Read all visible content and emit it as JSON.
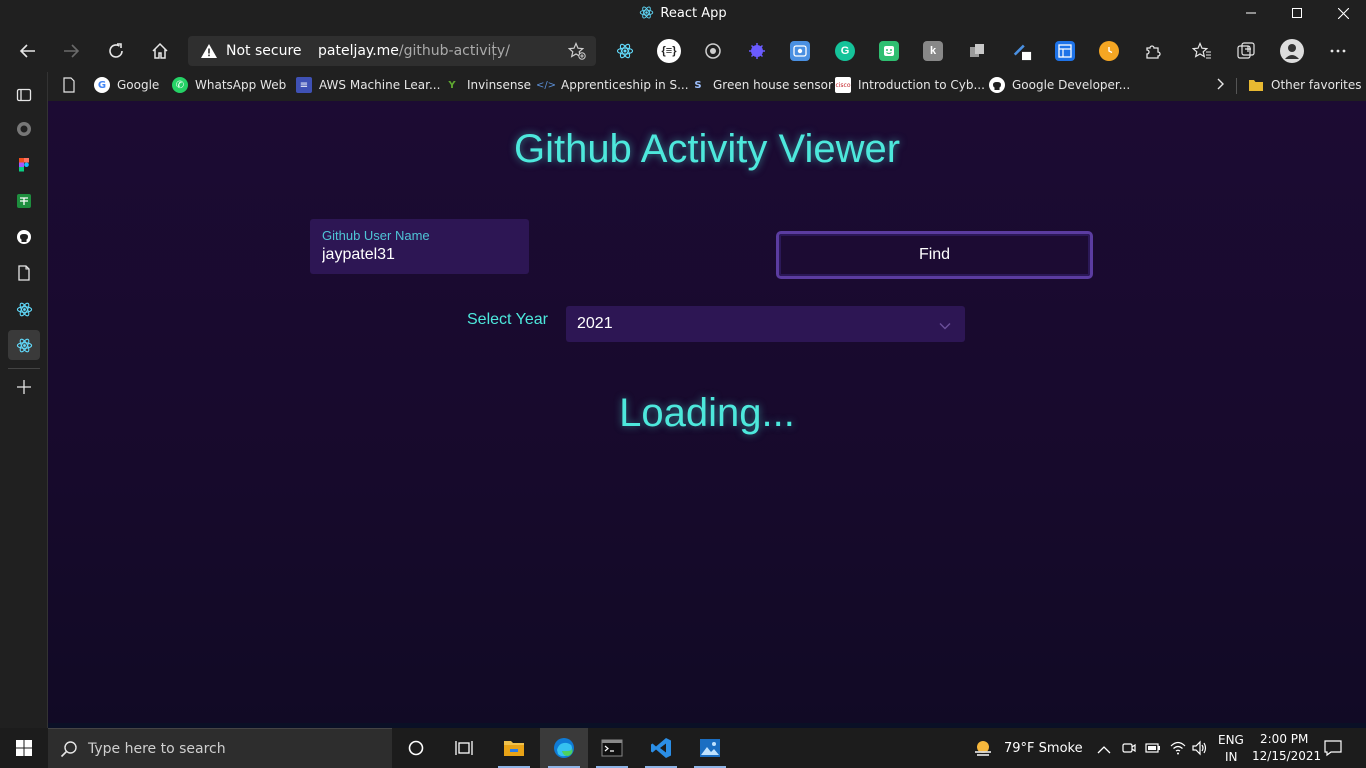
{
  "window": {
    "title": "React App"
  },
  "address": {
    "security": "Not secure",
    "domain": "pateljay.me",
    "path": "/github-activity/"
  },
  "favorites": [
    {
      "label": "Google",
      "color": "#ffffff"
    },
    {
      "label": "WhatsApp Web",
      "color": "#25d366"
    },
    {
      "label": "AWS Machine Lear...",
      "color": "#3f51b5"
    },
    {
      "label": "Invinsense",
      "color": "#5fa830"
    },
    {
      "label": "Apprenticeship in S...",
      "color": "#5b8fd6"
    },
    {
      "label": "Green house sensor",
      "color": "#3d6fb6"
    },
    {
      "label": "Introduction to Cyb...",
      "color": "#c32227"
    },
    {
      "label": "Google Developer...",
      "color": "#ffffff"
    }
  ],
  "favorites_other": "Other favorites",
  "page": {
    "title": "Github Activity Viewer",
    "username_label": "Github User Name",
    "username_value": "jaypatel31",
    "find_label": "Find",
    "year_label": "Select Year",
    "year_value": "2021",
    "loading": "Loading..."
  },
  "taskbar": {
    "search_placeholder": "Type here to search",
    "weather": "79°F  Smoke",
    "lang_top": "ENG",
    "lang_bottom": "IN",
    "time": "2:00 PM",
    "date": "12/15/2021"
  },
  "colors": {
    "accent": "#4de8dc",
    "field_bg": "#2d1654",
    "page_bg": "#1c0b33",
    "button_border": "#5b3ca0"
  }
}
